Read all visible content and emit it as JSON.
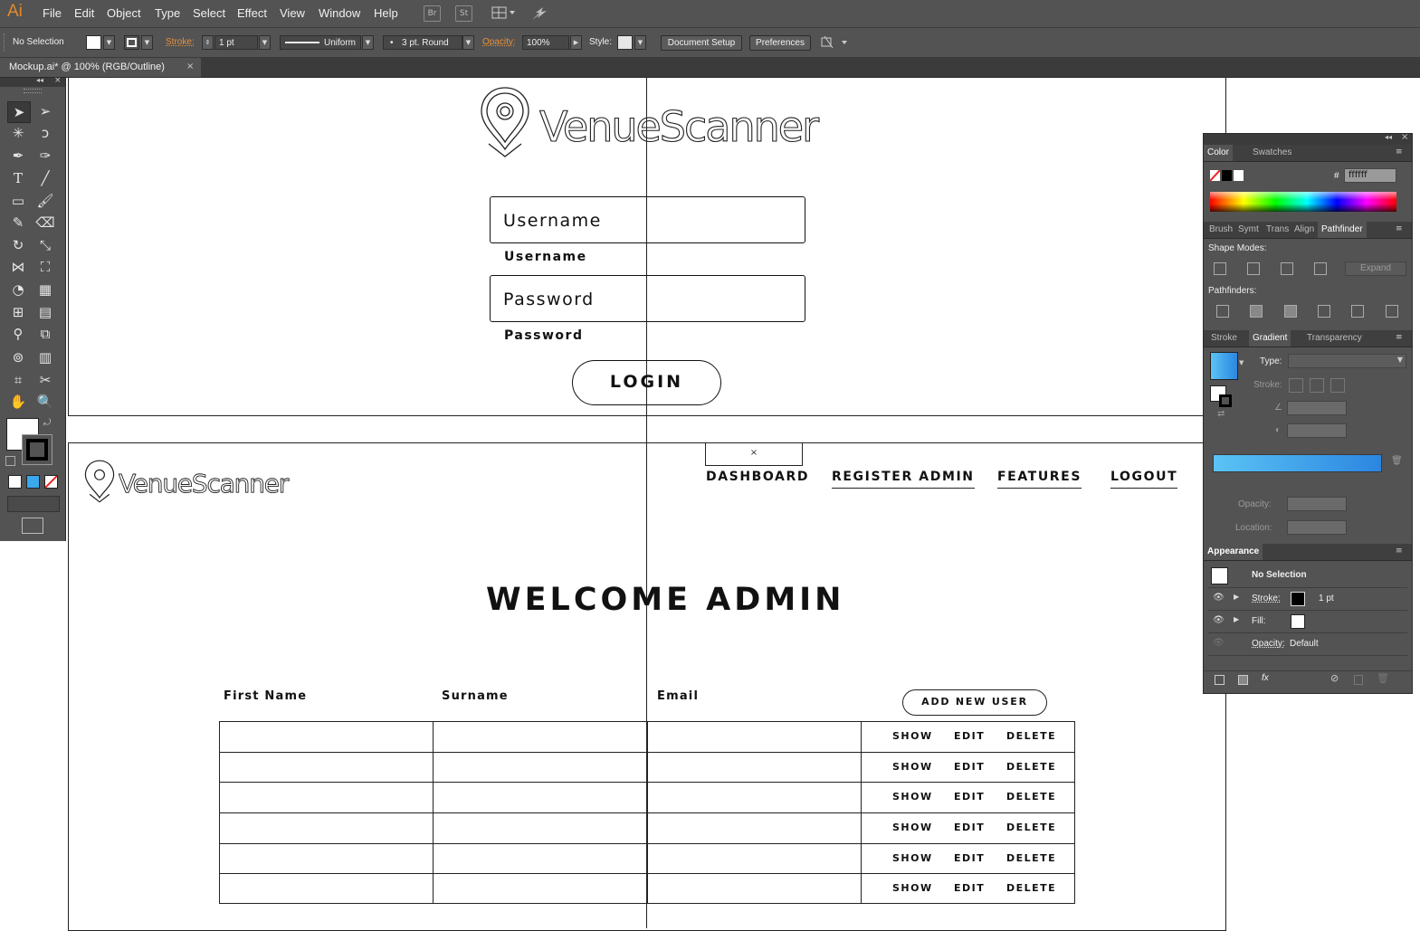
{
  "app": {
    "logo": "Ai",
    "menu": [
      "File",
      "Edit",
      "Object",
      "Type",
      "Select",
      "Effect",
      "View",
      "Window",
      "Help"
    ],
    "bridge_label": "Br",
    "stock_label": "St"
  },
  "control_bar": {
    "selection": "No Selection",
    "stroke_label": "Stroke:",
    "stroke_value": "1 pt",
    "profile": "Uniform",
    "brush": "3 pt. Round",
    "opacity_label": "Opacity:",
    "opacity_value": "100%",
    "style_label": "Style:",
    "document_setup": "Document Setup",
    "preferences": "Preferences"
  },
  "document_tab": {
    "title": "Mockup.ai* @ 100% (RGB/Outline)",
    "close": "×"
  },
  "mockup_login": {
    "logo_text": "VenueScanner",
    "username_placeholder": "Username",
    "username_label": "Username",
    "password_placeholder": "Password",
    "password_label": "Password",
    "login_button": "LOGIN"
  },
  "mockup_admin": {
    "logo_text": "VenueScanner",
    "close_box": "×",
    "nav": [
      "DASHBOARD",
      "REGISTER ADMIN",
      "FEATURES",
      "LOGOUT"
    ],
    "heading": "WELCOME ADMIN",
    "columns": [
      "First Name",
      "Surname",
      "Email"
    ],
    "add_user_button": "ADD NEW USER",
    "row_actions": [
      "SHOW",
      "EDIT",
      "DELETE"
    ],
    "row_count": 6
  },
  "color_panel": {
    "tabs": [
      "Color",
      "Swatches"
    ],
    "hex_label": "#",
    "hex_value": "ffffff"
  },
  "pathfinder_panel": {
    "tabs": [
      "Brush",
      "Symt",
      "Trans",
      "Align",
      "Pathfinder"
    ],
    "shape_modes_label": "Shape Modes:",
    "expand_button": "Expand",
    "pathfinders_label": "Pathfinders:"
  },
  "gradient_panel": {
    "tabs": [
      "Stroke",
      "Gradient",
      "Transparency"
    ],
    "type_label": "Type:",
    "stroke_label": "Stroke:",
    "opacity_label": "Opacity:",
    "location_label": "Location:",
    "gradient_start": "#5bc3f5",
    "gradient_end": "#2b86e0"
  },
  "appearance_panel": {
    "title": "Appearance",
    "selection": "No Selection",
    "stroke_label": "Stroke:",
    "stroke_value": "1 pt",
    "fill_label": "Fill:",
    "opacity_label": "Opacity:",
    "opacity_value": "Default",
    "fx_label": "fx"
  },
  "colors": {
    "ui_bg": "#535353",
    "ui_dark": "#3b3b3b",
    "accent_orange": "#e8923a"
  }
}
